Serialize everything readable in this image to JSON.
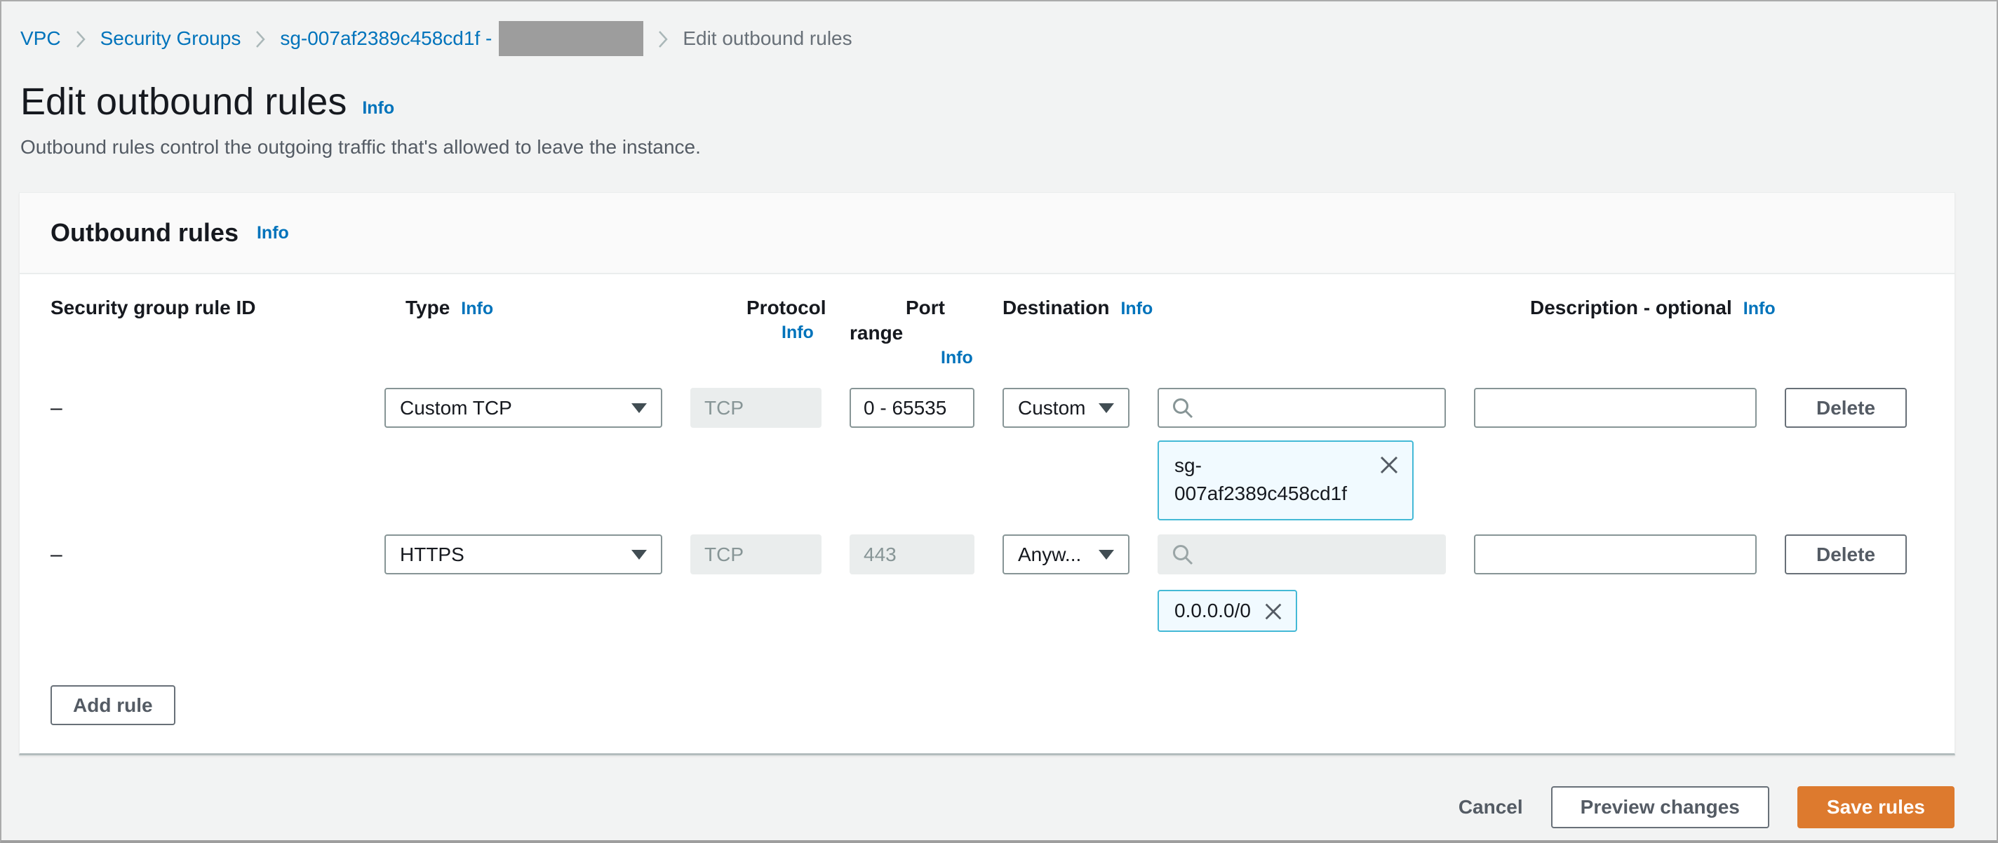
{
  "breadcrumb": {
    "items": [
      {
        "label": "VPC"
      },
      {
        "label": "Security Groups"
      },
      {
        "label": "sg-007af2389c458cd1f -"
      },
      {
        "label": "Edit outbound rules"
      }
    ]
  },
  "header": {
    "title": "Edit outbound rules",
    "info": "Info",
    "description": "Outbound rules control the outgoing traffic that's allowed to leave the instance."
  },
  "panel": {
    "title": "Outbound rules",
    "info": "Info"
  },
  "columns": {
    "rule_id": "Security group rule ID",
    "type": "Type",
    "protocol": "Protocol",
    "port_range": "Port range",
    "destination": "Destination",
    "description": "Description - optional",
    "info": "Info"
  },
  "rules": [
    {
      "rule_id": "–",
      "type": "Custom TCP",
      "protocol": "TCP",
      "port_range": "0 - 65535",
      "destination_mode": "Custom",
      "token": "sg-007af2389c458cd1f",
      "token_lines": [
        "sg-",
        "007af2389c458cd1f"
      ],
      "description_value": "",
      "delete_label": "Delete"
    },
    {
      "rule_id": "–",
      "type": "HTTPS",
      "protocol": "TCP",
      "port_range": "443",
      "destination_mode": "Anyw...",
      "token": "0.0.0.0/0",
      "description_value": "",
      "delete_label": "Delete"
    }
  ],
  "actions": {
    "add_rule": "Add rule",
    "cancel": "Cancel",
    "preview_changes": "Preview changes",
    "save_rules": "Save rules"
  },
  "colors": {
    "link_blue": "#0073bb",
    "primary_orange": "#dd7a2e",
    "token_border": "#44b9d6",
    "token_bg": "#f1faff",
    "disabled_bg": "#eaeded",
    "page_bg": "#f2f3f3"
  }
}
